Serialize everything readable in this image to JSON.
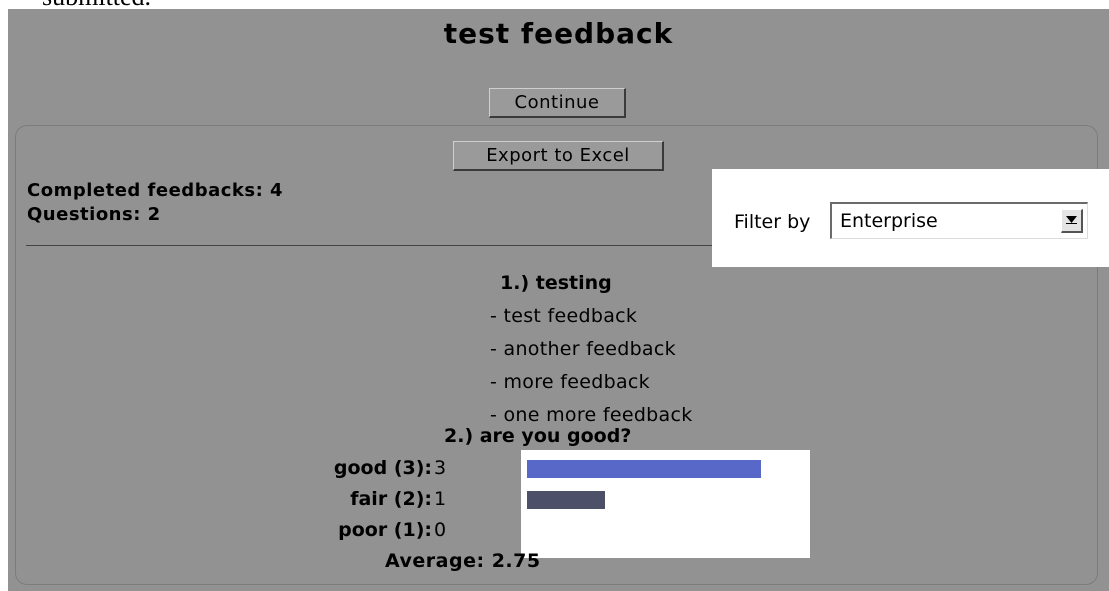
{
  "top_text": "submitted.",
  "page": {
    "title": "test feedback"
  },
  "buttons": {
    "continue": "Continue",
    "export": "Export to Excel"
  },
  "stats": {
    "completed": "Completed feedbacks: 4",
    "questions": "Questions: 2"
  },
  "filter": {
    "label": "Filter by",
    "selected": "Enterprise"
  },
  "question1": {
    "title": "1.) testing",
    "answers": [
      "- test feedback",
      "- another feedback",
      "- more feedback",
      "- one more feedback"
    ]
  },
  "question2": {
    "title": "2.) are you good?",
    "rows": [
      {
        "label": "good (3):",
        "count": "3",
        "fraction": 0.75,
        "color": "#5868c8"
      },
      {
        "label": "fair (2):",
        "count": "1",
        "fraction": 0.25,
        "color": "#4c5068"
      },
      {
        "label": "poor (1):",
        "count": "0",
        "fraction": 0.0,
        "color": "#4c5068"
      }
    ],
    "average": "Average: 2.75"
  },
  "colors": {
    "panel_bg": "#929292",
    "highlight_bg": "#ffffff"
  }
}
